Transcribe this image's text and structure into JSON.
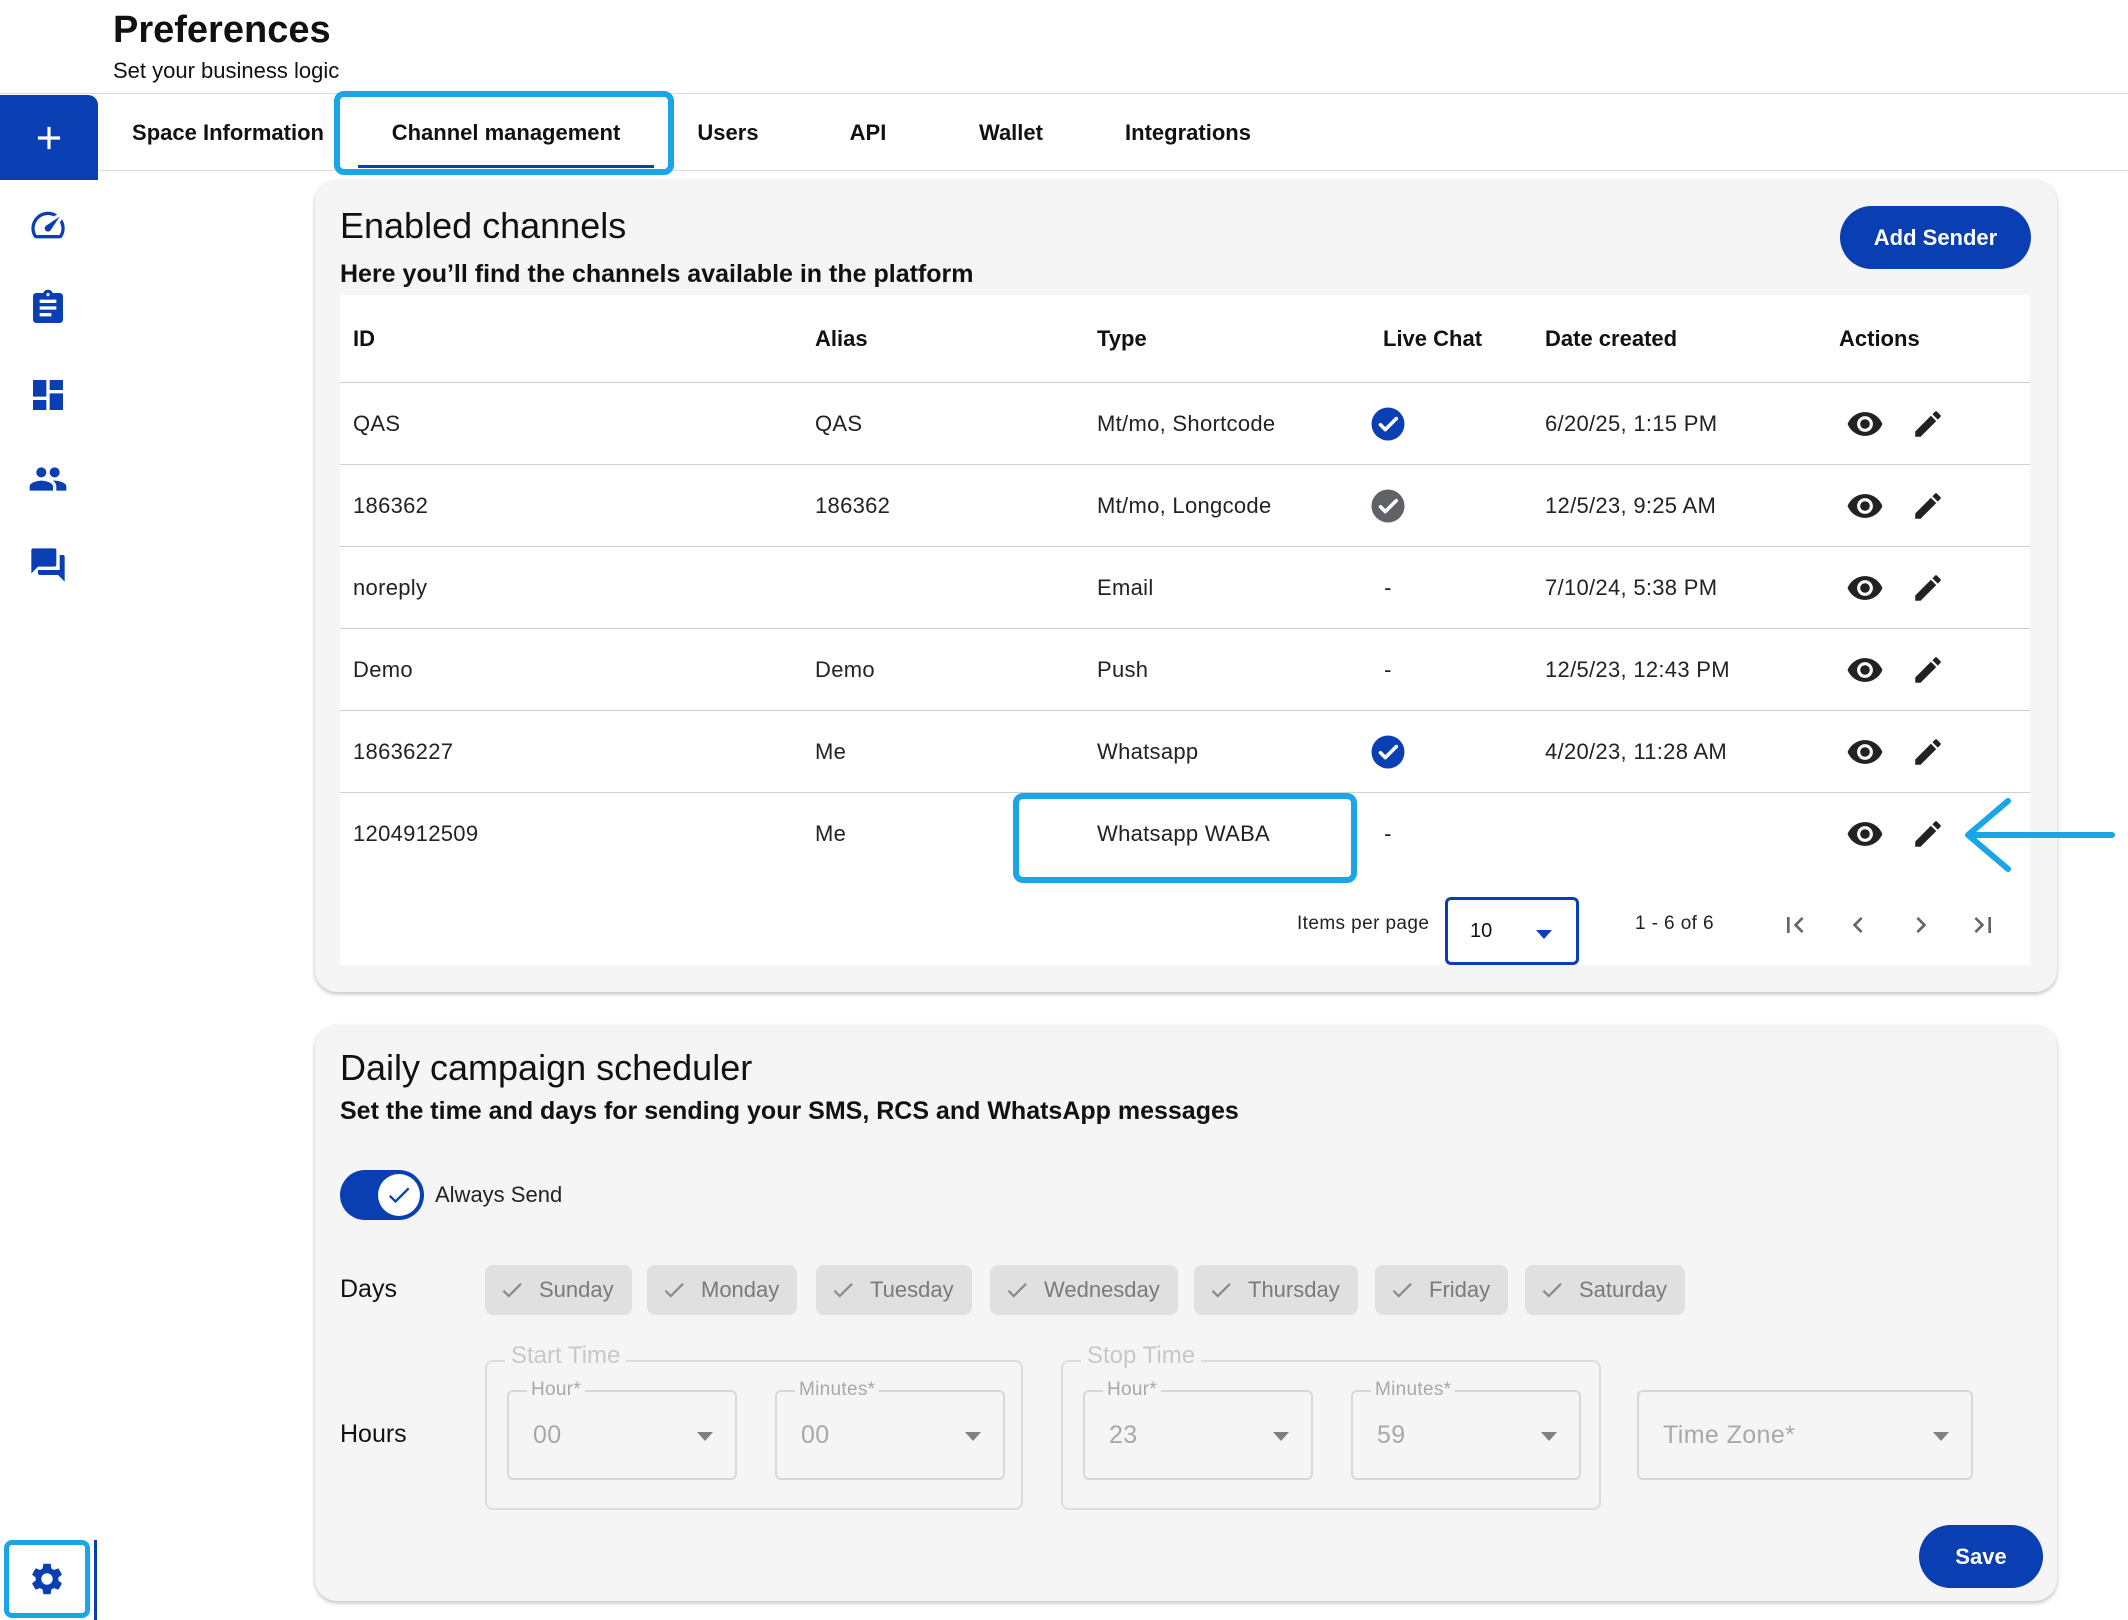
{
  "header": {
    "title": "Preferences",
    "subtitle": "Set your business logic"
  },
  "sidebar": {
    "items": [
      {
        "icon": "plus-icon"
      },
      {
        "icon": "speedometer-icon"
      },
      {
        "icon": "clipboard-icon"
      },
      {
        "icon": "dashboard-icon"
      },
      {
        "icon": "people-icon"
      },
      {
        "icon": "chat-icon"
      },
      {
        "icon": "gear-icon"
      }
    ]
  },
  "tabs": [
    {
      "label": "Space Information"
    },
    {
      "label": "Channel management",
      "active": true
    },
    {
      "label": "Users"
    },
    {
      "label": "API"
    },
    {
      "label": "Wallet"
    },
    {
      "label": "Integrations"
    }
  ],
  "channels": {
    "title": "Enabled channels",
    "subtitle": "Here you’ll find the channels available in the platform",
    "add_button": "Add Sender",
    "columns": [
      "ID",
      "Alias",
      "Type",
      "Live Chat",
      "Date created",
      "Actions"
    ],
    "rows": [
      {
        "id": "QAS",
        "alias": "QAS",
        "type": "Mt/mo, Shortcode",
        "live_chat": "check-blue",
        "live_chat_text": "",
        "date": "6/20/25, 1:15 PM"
      },
      {
        "id": "186362",
        "alias": "186362",
        "type": "Mt/mo, Longcode",
        "live_chat": "check-grey",
        "live_chat_text": "",
        "date": "12/5/23, 9:25 AM"
      },
      {
        "id": "noreply",
        "alias": "",
        "type": "Email",
        "live_chat": "none",
        "live_chat_text": "-",
        "date": "7/10/24, 5:38 PM"
      },
      {
        "id": "Demo",
        "alias": "Demo",
        "type": "Push",
        "live_chat": "none",
        "live_chat_text": "-",
        "date": "12/5/23, 12:43 PM"
      },
      {
        "id": "18636227",
        "alias": "Me",
        "type": "Whatsapp",
        "live_chat": "check-blue",
        "live_chat_text": "",
        "date": "4/20/23, 11:28 AM"
      },
      {
        "id": "1204912509",
        "alias": "Me",
        "type": "Whatsapp WABA",
        "live_chat": "none",
        "live_chat_text": "-",
        "date": ""
      }
    ],
    "paginator": {
      "items_per_page_label": "Items per page",
      "items_per_page": "10",
      "range": "1 - 6 of 6"
    },
    "colors": {
      "accent": "#0a3eb3",
      "highlight": "#1aa5e6",
      "check_grey": "#5f6368"
    }
  },
  "scheduler": {
    "title": "Daily campaign scheduler",
    "subtitle": "Set the time and days for sending your SMS, RCS and WhatsApp messages",
    "always_send_label": "Always Send",
    "always_send": true,
    "days_label": "Days",
    "days": [
      "Sunday",
      "Monday",
      "Tuesday",
      "Wednesday",
      "Thursday",
      "Friday",
      "Saturday"
    ],
    "hours_label": "Hours",
    "start_time": {
      "legend": "Start Time",
      "hour_label": "Hour*",
      "hour": "00",
      "minutes_label": "Minutes*",
      "minutes": "00"
    },
    "stop_time": {
      "legend": "Stop Time",
      "hour_label": "Hour*",
      "hour": "23",
      "minutes_label": "Minutes*",
      "minutes": "59"
    },
    "timezone_placeholder": "Time Zone*",
    "save_button": "Save"
  }
}
